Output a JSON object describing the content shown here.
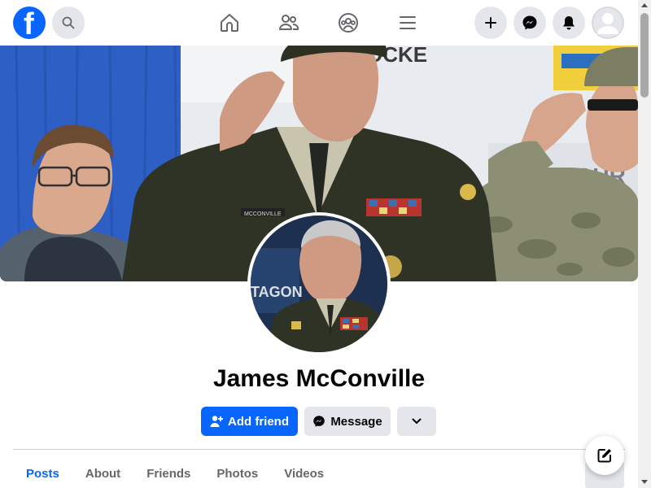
{
  "topbar": {
    "logo_letter": "f",
    "logo_icon": "facebook-logo-icon",
    "search_icon": "search-icon",
    "nav": [
      {
        "name": "home",
        "icon": "home-icon"
      },
      {
        "name": "friends",
        "icon": "friends-icon"
      },
      {
        "name": "groups",
        "icon": "groups-icon"
      },
      {
        "name": "menu",
        "icon": "hamburger-icon"
      }
    ],
    "actions": [
      {
        "name": "create",
        "icon": "plus-icon"
      },
      {
        "name": "messenger",
        "icon": "messenger-icon"
      },
      {
        "name": "notifications",
        "icon": "bell-icon"
      },
      {
        "name": "account",
        "icon": "avatar-icon"
      }
    ]
  },
  "profile": {
    "name": "James McConville",
    "cover_photo": "cover-photo",
    "profile_photo": "profile-photo"
  },
  "actions": {
    "add_friend_label": "Add friend",
    "message_label": "Message",
    "more_icon": "chevron-down-icon"
  },
  "tabs": [
    {
      "label": "Posts",
      "active": true
    },
    {
      "label": "About",
      "active": false
    },
    {
      "label": "Friends",
      "active": false
    },
    {
      "label": "Photos",
      "active": false
    },
    {
      "label": "Videos",
      "active": false
    }
  ],
  "colors": {
    "brand": "#0866ff",
    "button_gray": "#e4e6eb",
    "text_primary": "#050505",
    "text_secondary": "#65676b"
  }
}
